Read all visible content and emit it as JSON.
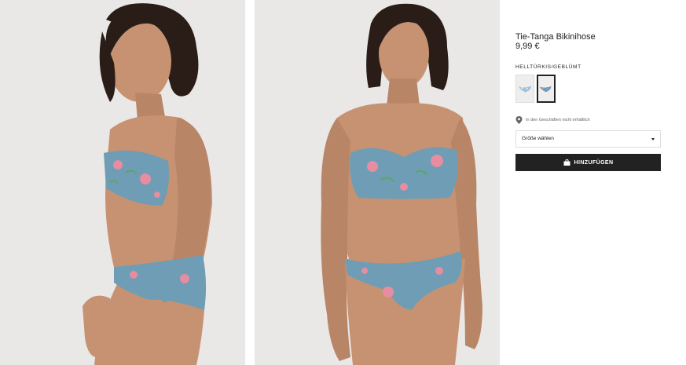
{
  "product": {
    "title": "Tie-Tanga Bikinihose",
    "price": "9,99 €"
  },
  "color": {
    "label": "HELLTÜRKIS/GEBLÜMT",
    "swatches": [
      {
        "icon": "light-blue-bikini-bottom-swatch",
        "selected": false
      },
      {
        "icon": "turquoise-floral-bikini-bottom-swatch",
        "selected": true
      }
    ]
  },
  "store": {
    "icon": "location-pin-icon",
    "availability": "In den Geschäften nicht erhältlich"
  },
  "size": {
    "placeholder": "Größe wählen",
    "icon": "caret-down-icon"
  },
  "add_to_cart": {
    "label": "HINZUFÜGEN",
    "icon": "shopping-bag-icon",
    "color": "#222222"
  },
  "images": [
    {
      "alt": "model-side-view-photo"
    },
    {
      "alt": "model-front-view-photo"
    }
  ],
  "colors": {
    "bikini": "#6f9db5",
    "photo_background": "#e9e8e7",
    "skin": "#c79272",
    "hair": "#2a1d17"
  }
}
